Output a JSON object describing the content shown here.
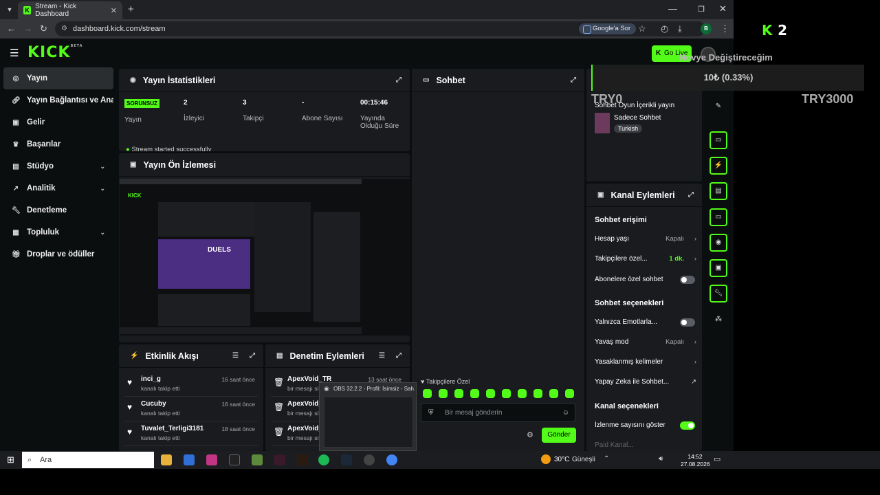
{
  "browser": {
    "tab_title": "Stream - Kick Dashboard",
    "url": "dashboard.kick.com/stream",
    "google_label": "Google'a Sor",
    "profile_initial": "B"
  },
  "header": {
    "logo": "KICK",
    "logo_beta": "BETA",
    "go_live": "Go Live"
  },
  "sidebar": {
    "items": [
      {
        "label": "Yayın",
        "icon": "broadcast-icon"
      },
      {
        "label": "Yayın Bağlantısı ve Anahtar",
        "icon": "link-icon"
      },
      {
        "label": "Gelir",
        "icon": "wallet-icon"
      },
      {
        "label": "Başarılar",
        "icon": "trophy-icon"
      },
      {
        "label": "Stüdyo",
        "icon": "studio-icon"
      },
      {
        "label": "Analitik",
        "icon": "chart-icon"
      },
      {
        "label": "Denetleme",
        "icon": "wrench-icon"
      },
      {
        "label": "Topluluk",
        "icon": "community-icon"
      },
      {
        "label": "Droplar ve ödüller",
        "icon": "gift-icon"
      }
    ]
  },
  "stats": {
    "title": "Yayın İstatistikleri",
    "status_badge": "SORUNSUZ",
    "status_label": "Yayın",
    "viewers_value": "2",
    "viewers_label": "İzleyici",
    "followers_value": "3",
    "followers_label": "Takipçi",
    "subs_value": "-",
    "subs_label": "Abone Sayısı",
    "uptime_value": "00:15:46",
    "uptime_label": "Yayında Olduğu Süre",
    "notice": "Stream started successfully"
  },
  "preview": {
    "title": "Yayın Ön İzlemesi"
  },
  "activity": {
    "title": "Etkinlik Akışı",
    "items": [
      {
        "name": "inci_g",
        "sub": "kanalı takip etti",
        "time": "16 saat önce"
      },
      {
        "name": "Cucuby",
        "sub": "kanalı takip etti",
        "time": "16 saat önce"
      },
      {
        "name": "Tuvalet_Terligi3181",
        "sub": "kanalı takip etti",
        "time": "18 saat önce"
      }
    ]
  },
  "moderation": {
    "title": "Denetim Eylemleri",
    "items": [
      {
        "name": "ApexVoid_TR",
        "sub": "bir mesajı sil",
        "time": "13 saat önce"
      },
      {
        "name": "ApexVoid_",
        "sub": "bir mesajı sil",
        "time": ""
      },
      {
        "name": "ApexVoid_",
        "sub": "bir mesajı sil",
        "time": ""
      }
    ]
  },
  "chat": {
    "title": "Sohbet",
    "followers_only": "Takipçilere Özel",
    "placeholder": "Bir mesaj gönderin",
    "send": "Gönder"
  },
  "stream_info": {
    "title_line": "Sohbet Oyun İçerikli yayın",
    "category": "Sadece Sohbet",
    "language": "Turkish"
  },
  "channel_actions": {
    "title": "Kanal Eylemleri",
    "chat_access": "Sohbet erişimi",
    "account_age": "Hesap yaşı",
    "account_age_value": "Kapalı",
    "followers_only": "Takipçilere özel...",
    "followers_only_value": "1 dk.",
    "subs_only": "Abonelere özel sohbet",
    "chat_options": "Sohbet seçenekleri",
    "emotes_only": "Yalnızca Emotlarla...",
    "slow_mode": "Yavaş mod",
    "slow_mode_value": "Kapalı",
    "banned_words": "Yasaklanmış kelimeler",
    "ai_chat": "Yapay Zeka ile Sohbet...",
    "channel_options": "Kanal seçenekleri",
    "show_viewers": "İzlenme sayısını göster",
    "paid": "Paid Kanal..."
  },
  "overlay": {
    "k_label": "K",
    "k_count": "2",
    "goal_text": "Novye Değiştireceğim",
    "rate": "10₺ (0.33%)",
    "try_left": "TRY0",
    "try_right": "TRY3000"
  },
  "obs": {
    "title": "OBS 32.2.2 - Profil: İsimsiz - Sah..."
  },
  "taskbar": {
    "search": "Ara",
    "weather": "30°C",
    "weather_desc": "Güneşli",
    "time": "14:52",
    "date": "27.08.2026"
  }
}
